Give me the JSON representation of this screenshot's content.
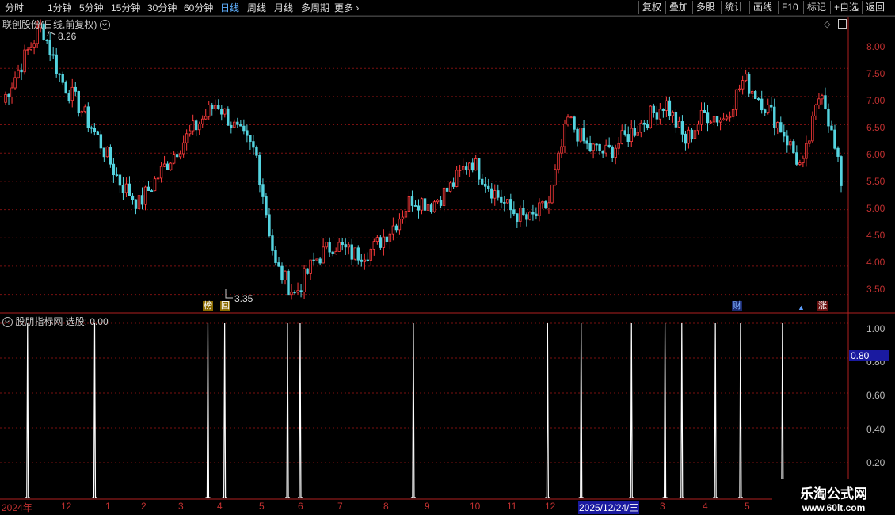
{
  "toolbar": {
    "periods": [
      "分时",
      "1分钟",
      "5分钟",
      "15分钟",
      "30分钟",
      "60分钟",
      "日线",
      "周线",
      "月线",
      "多周期",
      "更多"
    ],
    "active_period": "日线",
    "tools": [
      "复权",
      "叠加",
      "多股",
      "统计",
      "画线",
      "F10",
      "标记",
      "+自选",
      "返回"
    ]
  },
  "main_chart": {
    "title": "联创股份(日线,前复权)",
    "high_label": "8.26",
    "low_label": "3.35",
    "y_ticks": [
      "8.00",
      "7.50",
      "7.00",
      "6.50",
      "6.00",
      "5.50",
      "5.00",
      "4.50",
      "4.00",
      "3.50"
    ],
    "markers": {
      "bang": "榜",
      "hui": "回",
      "cai": "财",
      "zhang": "涨"
    }
  },
  "sub_chart": {
    "title": "股朋指标网",
    "value_label": "选股: 0.00",
    "y_ticks": [
      "1.00",
      "0.80",
      "0.60",
      "0.40",
      "0.20"
    ],
    "current_value": "0.80"
  },
  "x_axis": {
    "labels": [
      "2024年",
      "12",
      "1",
      "2",
      "3",
      "4",
      "5",
      "6",
      "7",
      "8",
      "9",
      "10",
      "11",
      "12",
      "2025/12/24/三",
      "3",
      "4",
      "5"
    ]
  },
  "watermark": {
    "line1": "乐淘公式网",
    "line2": "www.60lt.com"
  },
  "colors": {
    "up": "#ff3b3b",
    "down": "#54d4e0",
    "grid": "#7a1010",
    "axis": "#c03030",
    "signal": "#ffffff",
    "value_box": "#1a1aa0"
  },
  "chart_data": [
    {
      "type": "candlestick",
      "title": "联创股份(日线,前复权)",
      "ylim": [
        3.2,
        8.4
      ],
      "x": [
        "2024年",
        "12",
        "1",
        "2",
        "3",
        "4",
        "5",
        "6",
        "7",
        "8",
        "9",
        "10",
        "11",
        "12",
        "2025/12/24/三",
        "3",
        "4",
        "5"
      ],
      "close_path": [
        6.9,
        7.6,
        8.26,
        7.3,
        6.8,
        6.2,
        5.5,
        5.1,
        5.6,
        6.1,
        6.5,
        6.9,
        6.4,
        6.0,
        4.0,
        3.5,
        4.1,
        4.4,
        4.2,
        4.3,
        4.7,
        5.2,
        5.1,
        5.4,
        5.9,
        5.4,
        5.0,
        4.8,
        5.1,
        6.6,
        6.1,
        6.0,
        6.3,
        6.6,
        6.9,
        6.2,
        6.7,
        6.6,
        7.3,
        6.9,
        6.4,
        5.7,
        7.2,
        5.5
      ],
      "annotations": {
        "high": 8.26,
        "low": 3.35
      }
    },
    {
      "type": "line",
      "title": "股朋指标网",
      "ylim": [
        0,
        1.05
      ],
      "x": [
        "2024年",
        "12",
        "1",
        "2",
        "3",
        "4",
        "5",
        "6",
        "7",
        "8",
        "9",
        "10",
        "11",
        "12",
        "2025/12/24/三",
        "3",
        "4",
        "5"
      ],
      "signals": [
        0.03,
        0.11,
        0.245,
        0.265,
        0.34,
        0.355,
        0.49,
        0.65,
        0.69,
        0.75,
        0.79,
        0.81,
        0.85,
        0.88,
        0.93
      ],
      "series": [
        {
          "name": "选股",
          "values": [
            1,
            1,
            1,
            1,
            1,
            1,
            1,
            1,
            1,
            1,
            1,
            1,
            1,
            1,
            1
          ]
        }
      ]
    }
  ]
}
